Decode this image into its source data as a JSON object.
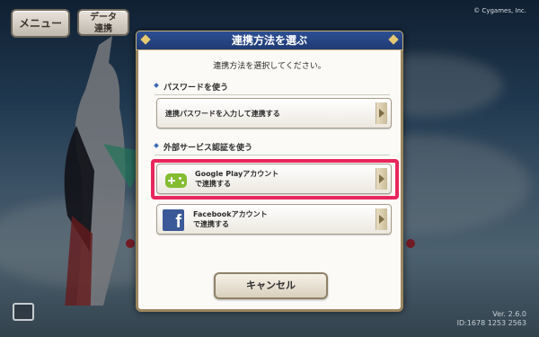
{
  "top": {
    "menu_label": "メニュー",
    "data_label_line1": "データ",
    "data_label_line2": "連携",
    "copyright": "© Cygames, Inc.",
    "version_line1": "Ver. 2.6.0",
    "version_line2": "ID:1678 1253 2563"
  },
  "dialog": {
    "title": "連携方法を選ぶ",
    "subtitle": "連携方法を選択してください。",
    "password_section": {
      "title": "パスワードを使う",
      "button_label": "連携パスワードを入力して連携する"
    },
    "external_section": {
      "title": "外部サービス認証を使う",
      "google_line1": "Google Playアカウント",
      "google_line2": "で連携する",
      "facebook_line1": "Facebookアカウント",
      "facebook_line2": "で連携する"
    },
    "cancel_label": "キャンセル"
  },
  "colors": {
    "header_blue": "#203b74",
    "highlight": "#e8265b",
    "google_play_green": "#84bd32",
    "facebook_blue": "#3b5998"
  },
  "icons": {
    "google": "google-play-games-controller-icon",
    "facebook": "facebook-f-icon",
    "arrow": "chevron-right-icon"
  }
}
